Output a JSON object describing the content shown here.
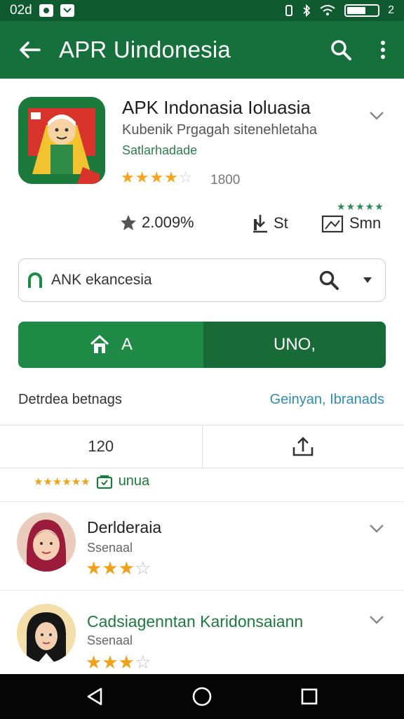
{
  "status_bar": {
    "time": "02d",
    "battery_text": "2"
  },
  "app_bar": {
    "title": "APR Uindonesia"
  },
  "app": {
    "name": "APK Indonasia Ioluasia",
    "subtitle": "Kubenik Prgagah sitenehletaha",
    "developer": "Satlarhadade",
    "rating_count": "1800",
    "stats": {
      "percent": "2.009%",
      "downloads": "St",
      "size": "Smn"
    }
  },
  "search": {
    "value": "ANK ekancesia"
  },
  "buttons": {
    "primary_label": "A",
    "secondary_label": "UNO,"
  },
  "section": {
    "title": "Detrdea betnags",
    "link": "Geinyan, Ibranads"
  },
  "tabs": {
    "count_label": "120"
  },
  "rating_summary": {
    "stars": "★★★★★★",
    "label": "unua"
  },
  "reviews": [
    {
      "name": "Derlderaia",
      "subtitle": "Ssenaal",
      "rating": 3,
      "max": 5
    },
    {
      "name": "Cadsiagenntan Karidonsaiann",
      "subtitle": "Ssenaal",
      "rating": 2.5,
      "max": 5
    }
  ],
  "colors": {
    "primary": "#15703b",
    "statusbar": "#0f5a2e",
    "star": "#f0a11a",
    "link": "#2f8db0"
  },
  "icons": [
    "back-arrow-icon",
    "search-icon",
    "more-vert-icon",
    "star-icon",
    "download-icon",
    "size-icon",
    "chevron-down-icon",
    "home-icon",
    "share-icon",
    "nav-back-icon",
    "nav-home-icon",
    "nav-recents-icon"
  ]
}
